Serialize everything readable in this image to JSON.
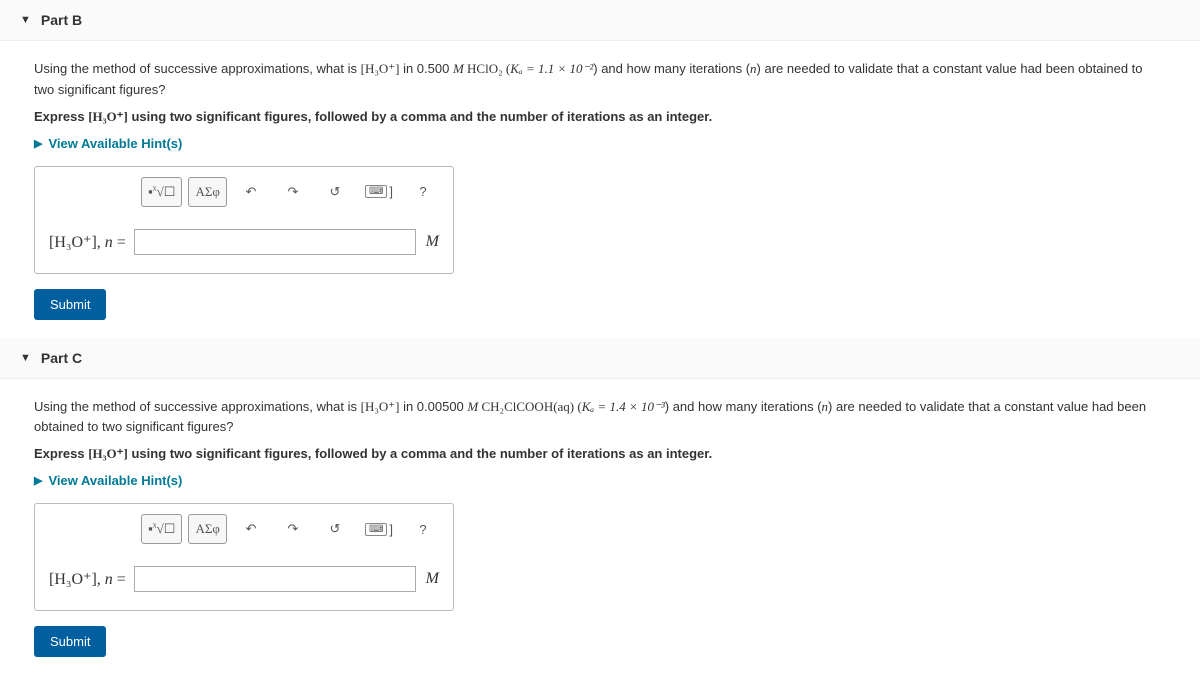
{
  "partB": {
    "title": "Part B",
    "question_pre": "Using the method of successive approximations, what is ",
    "question_expr": "[H₃O⁺]",
    "question_mid": " in 0.500 ",
    "question_M": "M",
    "question_compound": " HClO₂ (",
    "question_Ka": "Kₐ = 1.1 × 10⁻²",
    "question_post": ") and how many iterations (",
    "question_n": "n",
    "question_end": ") are needed to validate that a constant value had been obtained to two significant figures?",
    "instruction_pre": "Express ",
    "instruction_expr": "[H₃O⁺]",
    "instruction_post": " using two significant figures, followed by a comma and the number of iterations as an integer.",
    "hints_label": "View Available Hint(s)",
    "toolbar": {
      "templates": "ᴰ√☐",
      "greek": "ΑΣφ",
      "help": "?"
    },
    "answer_label_expr": "[H₃O⁺], ",
    "answer_label_n": "n",
    "answer_label_eq": " = ",
    "answer_value": "",
    "unit": "M",
    "submit": "Submit"
  },
  "partC": {
    "title": "Part C",
    "question_pre": "Using the method of successive approximations, what is ",
    "question_expr": "[H₃O⁺]",
    "question_mid": " in 0.00500 ",
    "question_M": "M",
    "question_compound": " CH₂ClCOOH(aq) (",
    "question_Ka": "Kₐ = 1.4 × 10⁻³",
    "question_post": ") and how many iterations (",
    "question_n": "n",
    "question_end": ") are needed to validate that a constant value had been obtained to two significant figures?",
    "instruction_pre": "Express ",
    "instruction_expr": "[H₃O⁺]",
    "instruction_post": " using two significant figures, followed by a comma and the number of iterations as an integer.",
    "hints_label": "View Available Hint(s)",
    "toolbar": {
      "templates": "ᴰ√☐",
      "greek": "ΑΣφ",
      "help": "?"
    },
    "answer_label_expr": "[H₃O⁺], ",
    "answer_label_n": "n",
    "answer_label_eq": " = ",
    "answer_value": "",
    "unit": "M",
    "submit": "Submit"
  }
}
